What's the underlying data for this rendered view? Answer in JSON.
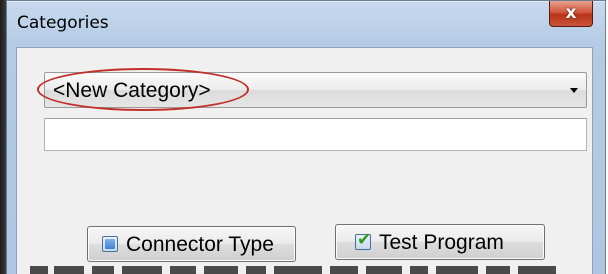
{
  "window": {
    "title": "Categories",
    "close_glyph": "x"
  },
  "category_combo": {
    "selected": "<New Category>",
    "arrow_icon": "dropdown-arrow-icon"
  },
  "name_field": {
    "value": ""
  },
  "buttons": {
    "connector_type": {
      "label": "Connector Type",
      "checked": false
    },
    "test_program": {
      "label": "Test Program",
      "checked": true,
      "check_glyph": "✔"
    }
  },
  "colors": {
    "highlight_ellipse": "#c0302a",
    "close_button": "#c9543a",
    "checkmark": "#2f9a1e",
    "checkbox_fill": "#3f82d3"
  }
}
